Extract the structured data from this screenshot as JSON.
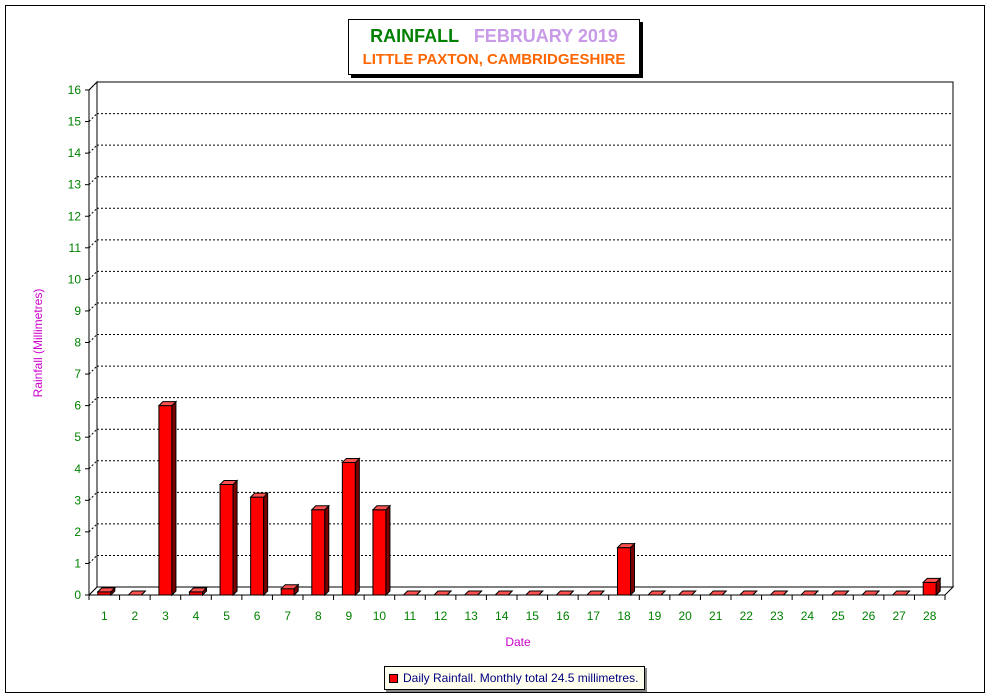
{
  "title": {
    "label": "RAINFALL",
    "period": "FEBRUARY 2019",
    "location": "LITTLE PAXTON, CAMBRIDGESHIRE"
  },
  "colors": {
    "bar_front": "#ff0000",
    "bar_side": "#7a0000",
    "bar_top": "#ff5050",
    "axis_tick_text": "#008000",
    "axis_title": "#cc00cc",
    "legend_text": "#000080"
  },
  "legend": {
    "label": "Daily Rainfall. Monthly total 24.5 millimetres."
  },
  "chart_data": {
    "type": "bar",
    "title": "RAINFALL   FEBRUARY 2019",
    "subtitle": "LITTLE PAXTON, CAMBRIDGESHIRE",
    "xlabel": "Date",
    "ylabel": "Rainfall  (Millimetres)",
    "ylim": [
      0,
      16
    ],
    "yticks": [
      0,
      1,
      2,
      3,
      4,
      5,
      6,
      7,
      8,
      9,
      10,
      11,
      12,
      13,
      14,
      15,
      16
    ],
    "grid": "horizontal dashed",
    "legend_position": "bottom",
    "categories": [
      "1",
      "2",
      "3",
      "4",
      "5",
      "6",
      "7",
      "8",
      "9",
      "10",
      "11",
      "12",
      "13",
      "14",
      "15",
      "16",
      "17",
      "18",
      "19",
      "20",
      "21",
      "22",
      "23",
      "24",
      "25",
      "26",
      "27",
      "28"
    ],
    "series": [
      {
        "name": "Daily Rainfall. Monthly total 24.5 millimetres.",
        "values": [
          0.1,
          0,
          6.0,
          0.1,
          3.5,
          3.1,
          0.2,
          2.7,
          4.2,
          2.7,
          0,
          0,
          0,
          0,
          0,
          0,
          0,
          1.5,
          0,
          0,
          0,
          0,
          0,
          0,
          0,
          0,
          0,
          0.4
        ]
      }
    ]
  }
}
